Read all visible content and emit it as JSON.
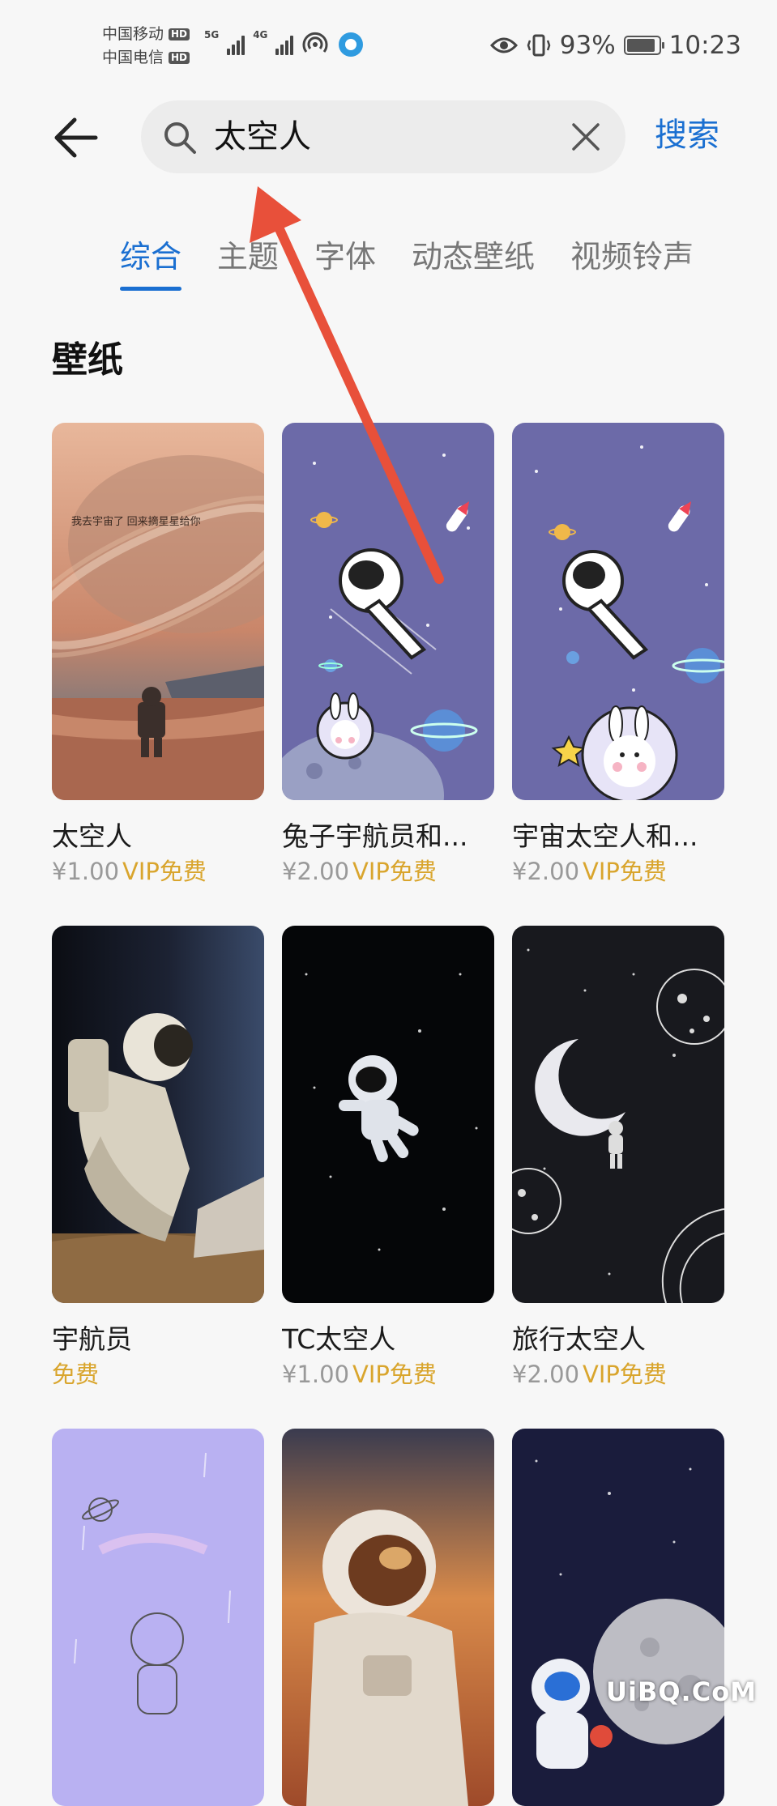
{
  "status": {
    "carrier1": "中国移动",
    "carrier2": "中国电信",
    "hd": "HD",
    "net1": "5G",
    "net2": "4G",
    "battery": "93%",
    "time": "10:23"
  },
  "header": {
    "query": "太空人",
    "search_label": "搜索"
  },
  "tabs": [
    {
      "label": "综合",
      "active": true
    },
    {
      "label": "主题",
      "active": false
    },
    {
      "label": "字体",
      "active": false
    },
    {
      "label": "动态壁纸",
      "active": false
    },
    {
      "label": "视频铃声",
      "active": false
    }
  ],
  "section": {
    "title": "壁纸"
  },
  "wallpapers": [
    {
      "title": "太空人",
      "price": "¥1.00",
      "vip": "VIP免费",
      "art_text": "我去宇宙了 回来摘星星给你"
    },
    {
      "title": "兔子宇航员和...",
      "price": "¥2.00",
      "vip": "VIP免费"
    },
    {
      "title": "宇宙太空人和...",
      "price": "¥2.00",
      "vip": "VIP免费"
    },
    {
      "title": "宇航员",
      "price": "",
      "vip": "",
      "free": "免费"
    },
    {
      "title": "TC太空人",
      "price": "¥1.00",
      "vip": "VIP免费"
    },
    {
      "title": "旅行太空人",
      "price": "¥2.00",
      "vip": "VIP免费"
    },
    {
      "title": "",
      "price": "",
      "vip": ""
    },
    {
      "title": "",
      "price": "",
      "vip": ""
    },
    {
      "title": "",
      "price": "",
      "vip": ""
    }
  ],
  "watermark": "UiBQ.CoM",
  "colors": {
    "accent": "#1a6fd1",
    "vip": "#d9a52d",
    "annotation": "#e8503a"
  }
}
